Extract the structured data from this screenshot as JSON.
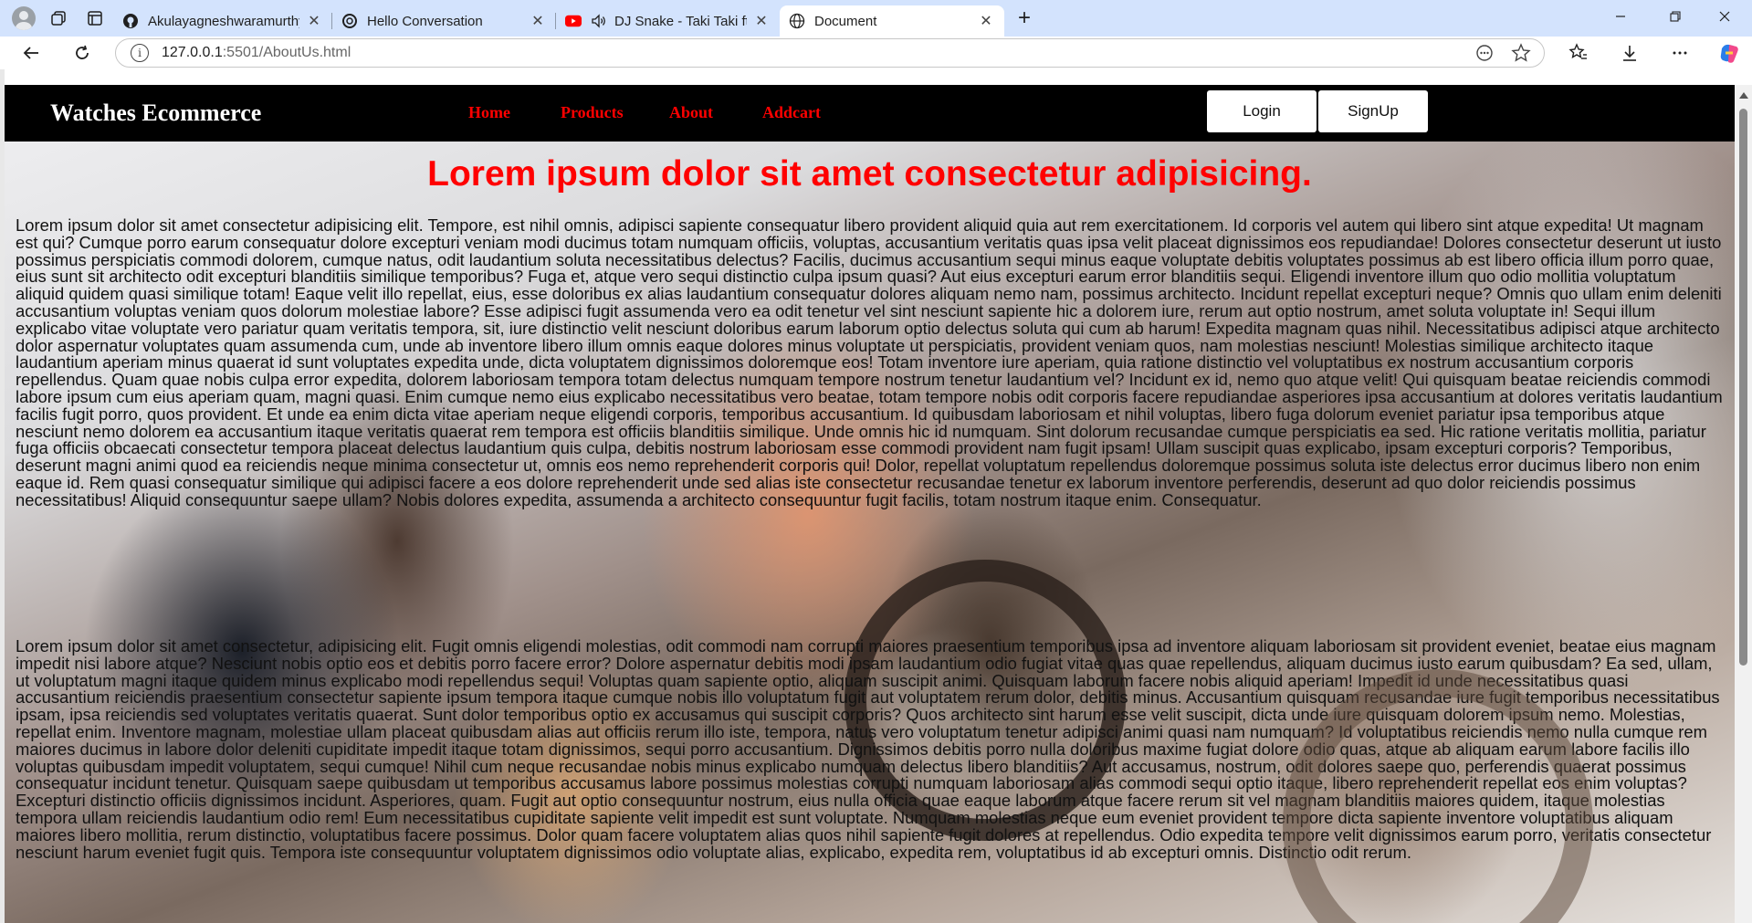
{
  "browser": {
    "tabs": [
      {
        "title": "Akulayagneshwaramurthy/Fresh-l",
        "icon": "github-icon"
      },
      {
        "title": "Hello Conversation",
        "icon": "openai-icon"
      },
      {
        "title": "DJ Snake - Taki Taki ft. Selena",
        "icon": "youtube-icon"
      },
      {
        "title": "Document",
        "icon": "globe-icon",
        "active": true
      }
    ],
    "url_host": "127.0.0.1",
    "url_rest": ":5501/AboutUs.html"
  },
  "site": {
    "brand": "Watches Ecommerce",
    "nav": {
      "home": "Home",
      "products": "Products",
      "about": "About",
      "addcart": "Addcart"
    },
    "login": "Login",
    "signup": "SignUp"
  },
  "content": {
    "headline": "Lorem ipsum dolor sit amet consectetur adipisicing.",
    "paragraph1": "Lorem ipsum dolor sit amet consectetur adipisicing elit. Tempore, est nihil omnis, adipisci sapiente consequatur libero provident aliquid quia aut rem exercitationem. Id corporis vel autem qui libero sint atque expedita! Ut magnam est qui? Cumque porro earum consequatur dolore excepturi veniam modi ducimus totam numquam officiis, voluptas, accusantium veritatis quas ipsa velit placeat dignissimos eos repudiandae! Dolores consectetur deserunt ut iusto possimus perspiciatis commodi dolorem, cumque natus, odit laudantium soluta necessitatibus delectus? Facilis, ducimus accusantium sequi minus eaque voluptate debitis voluptates possimus ab est libero officia illum porro quae, eius sunt sit architecto odit excepturi blanditiis similique temporibus? Fuga et, atque vero sequi distinctio culpa ipsum quasi? Aut eius excepturi earum error blanditiis sequi. Eligendi inventore illum quo odio mollitia voluptatum aliquid quidem quasi similique totam! Eaque velit illo repellat, eius, esse doloribus ex alias laudantium consequatur dolores aliquam nemo nam, possimus architecto. Incidunt repellat excepturi neque? Omnis quo ullam enim deleniti accusantium voluptas veniam quos dolorum molestiae labore? Esse adipisci fugit assumenda vero ea odit tenetur vel sint nesciunt sapiente hic a dolorem iure, rerum aut optio nostrum, amet soluta voluptate in! Sequi illum explicabo vitae voluptate vero pariatur quam veritatis tempora, sit, iure distinctio velit nesciunt doloribus earum laborum optio delectus soluta qui cum ab harum! Expedita magnam quas nihil. Necessitatibus adipisci atque architecto dolor aspernatur voluptates quam assumenda cum, unde ab inventore libero illum omnis eaque dolores minus voluptate ut perspiciatis, provident veniam quos, nam molestias nesciunt! Molestias similique architecto itaque laudantium aperiam minus quaerat id sunt voluptates expedita unde, dicta voluptatem dignissimos doloremque eos! Totam inventore iure aperiam, quia ratione distinctio vel voluptatibus ex nostrum accusantium corporis repellendus. Quam quae nobis culpa error expedita, dolorem laboriosam tempora totam delectus numquam tempore nostrum tenetur laudantium vel? Incidunt ex id, nemo quo atque velit! Qui quisquam beatae reiciendis commodi labore ipsum cum eius aperiam quam, magni quasi. Enim cumque nemo eius explicabo necessitatibus vero beatae, totam tempore nobis odit corporis facere repudiandae asperiores ipsa accusantium at dolores veritatis laudantium facilis fugit porro, quos provident. Et unde ea enim dicta vitae aperiam neque eligendi corporis, temporibus accusantium. Id quibusdam laboriosam et nihil voluptas, libero fuga dolorum eveniet pariatur ipsa temporibus atque nesciunt nemo dolorem ea accusantium itaque veritatis quaerat rem tempora est officiis blanditiis similique. Unde omnis hic id numquam. Sint dolorum recusandae cumque perspiciatis ea sed. Hic ratione veritatis mollitia, pariatur fuga officiis obcaecati consectetur tempora placeat delectus laudantium quis culpa, debitis nostrum laboriosam esse commodi provident nam fugit ipsam! Ullam suscipit quas explicabo, ipsam excepturi corporis? Temporibus, deserunt magni animi quod ea reiciendis neque minima consectetur ut, omnis eos nemo reprehenderit corporis qui! Dolor, repellat voluptatum repellendus doloremque possimus soluta iste delectus error ducimus libero non enim eaque id. Rem quasi consequatur similique qui adipisci facere a eos dolore reprehenderit unde sed alias iste consectetur recusandae tenetur ex laborum inventore perferendis, deserunt ad quo dolor reiciendis possimus necessitatibus! Aliquid consequuntur saepe ullam? Nobis dolores expedita, assumenda a architecto consequuntur fugit facilis, totam nostrum itaque enim. Consequatur.",
    "paragraph2": "Lorem ipsum dolor sit amet consectetur, adipisicing elit. Fugit omnis eligendi molestias, odit commodi nam corrupti maiores praesentium temporibus ipsa ad inventore aliquam laboriosam sit provident eveniet, beatae eius magnam impedit nisi labore atque? Nesciunt nobis optio eos et debitis porro facere error? Dolore aspernatur debitis modi ipsam laudantium odio fugiat vitae quas quae repellendus, aliquam ducimus iusto earum quibusdam? Ea sed, ullam, ut voluptatum magni itaque quidem minus explicabo modi repellendus sequi! Voluptas quam sapiente optio, aliquam suscipit animi. Quisquam laborum facere nobis aliquid aperiam! Impedit id unde necessitatibus quasi accusantium reiciendis praesentium consectetur sapiente ipsum tempora itaque cumque nobis illo voluptatum fugit aut voluptatem rerum dolor, debitis minus. Accusantium quisquam recusandae iure fugit temporibus necessitatibus ipsam, ipsa reiciendis sed voluptates veritatis quaerat. Sunt dolor temporibus optio ex accusamus qui suscipit corporis? Quos architecto sint harum esse velit suscipit, dicta unde iure quisquam dolorem ipsum nemo. Molestias, repellat enim. Inventore magnam, molestiae ullam placeat quibusdam alias aut officiis rerum illo iste, tempora, natus vero voluptatum tenetur adipisci animi quasi nam numquam? Id voluptatibus reiciendis nemo nulla cumque rem maiores ducimus in labore dolor deleniti cupiditate impedit itaque totam dignissimos, sequi porro accusantium. Dignissimos debitis porro nulla doloribus maxime fugiat dolore odio quas, atque ab aliquam earum labore facilis illo voluptas quibusdam impedit voluptatem, sequi cumque! Nihil cum neque recusandae nobis minus explicabo numquam delectus libero blanditiis? Aut accusamus, nostrum, odit dolores saepe quo, perferendis quaerat possimus consequatur incidunt tenetur. Quisquam saepe quibusdam ut temporibus accusamus labore possimus molestias corrupti numquam laboriosam alias commodi sequi optio itaque, libero reprehenderit repellat eos enim voluptas? Excepturi distinctio officiis dignissimos incidunt. Asperiores, quam. Fugit aut optio consequuntur nostrum, eius nulla officia quae eaque laborum atque facere rerum sit vel magnam blanditiis maiores quidem, itaque molestias tempora ullam reiciendis laudantium odio rem! Eum necessitatibus cupiditate sapiente velit impedit est sunt voluptate. Numquam molestias neque eum eveniet provident tempore dicta sapiente inventore voluptatibus aliquam maiores libero mollitia, rerum distinctio, voluptatibus facere possimus. Dolor quam facere voluptatem alias quos nihil sapiente fugit dolores at repellendus. Odio expedita tempore velit dignissimos earum porro, veritatis consectetur nesciunt harum eveniet fugit quis. Tempora iste consequuntur voluptatem dignissimos odio voluptate alias, explicabo, expedita rem, voluptatibus id ab excepturi omnis. Distinctio odit rerum."
  }
}
